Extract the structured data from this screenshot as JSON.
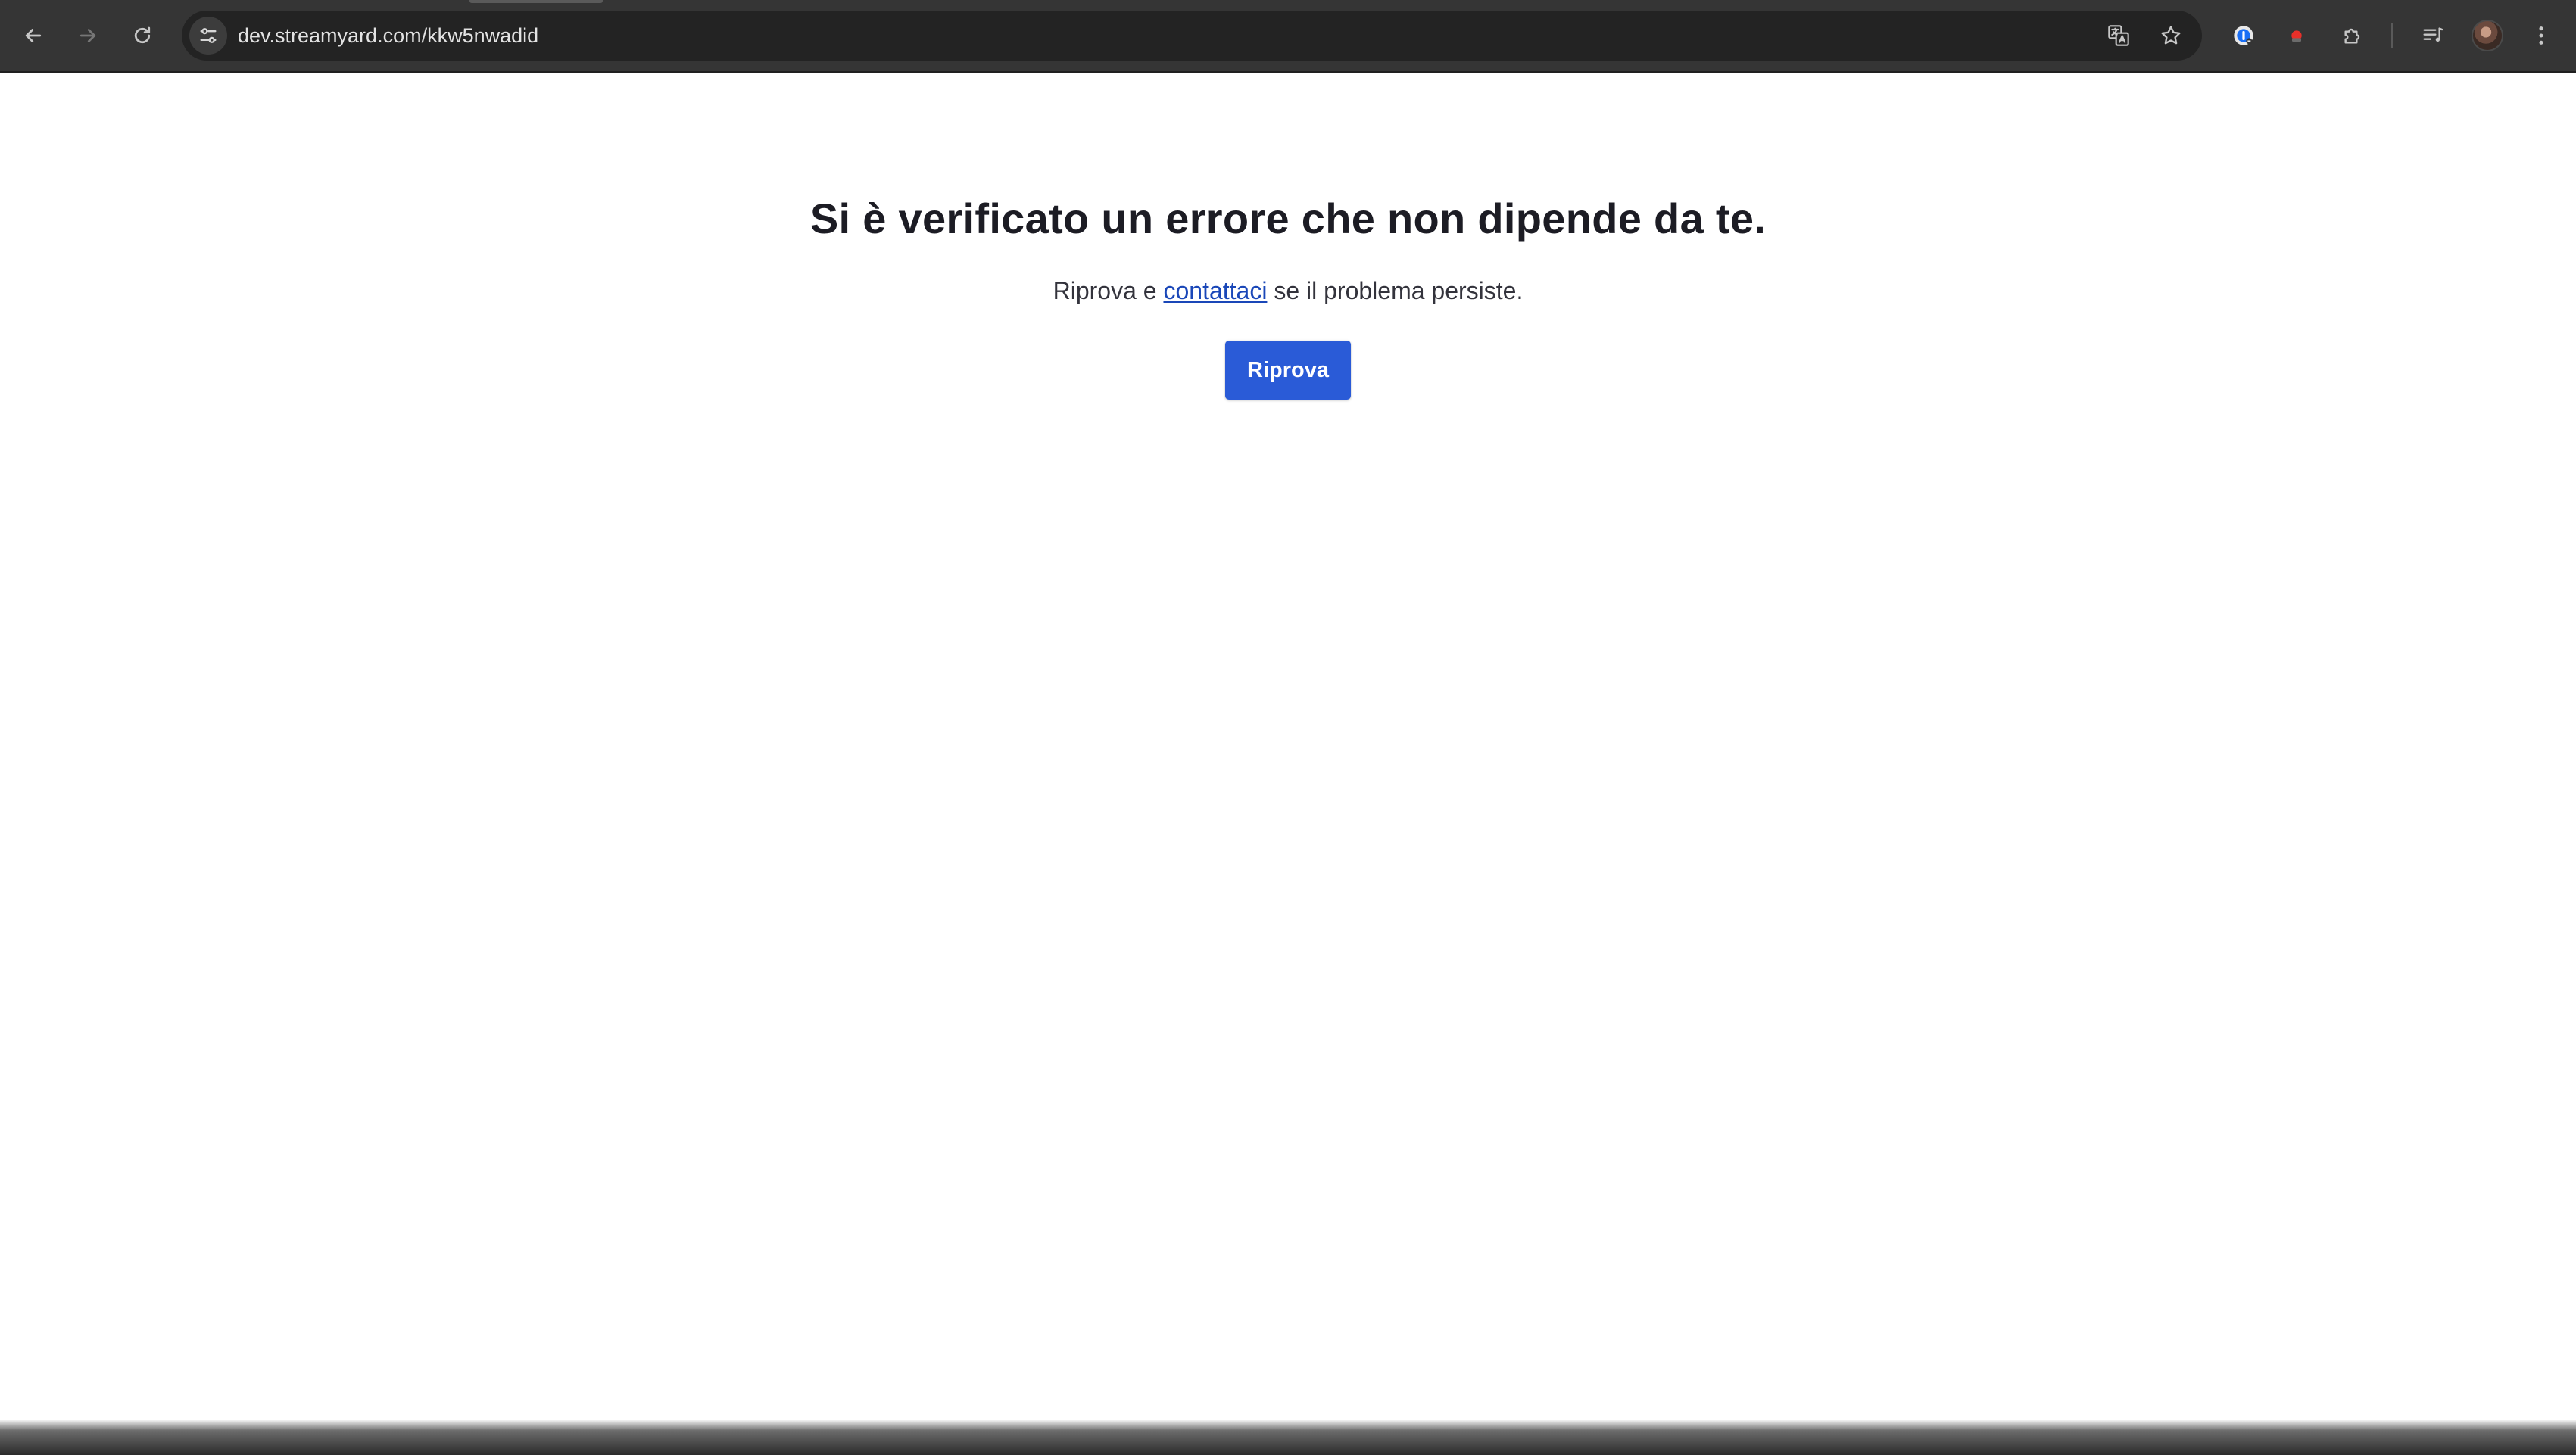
{
  "browser": {
    "url": "dev.streamyard.com/kkw5nwadid",
    "icons": {
      "back": "arrow-left-icon",
      "forward": "arrow-right-icon",
      "reload": "reload-icon",
      "site_info": "tune-icon",
      "translate": "translate-icon",
      "bookmark": "star-icon",
      "extension_1": "password-manager-icon",
      "extension_2": "record-icon",
      "extensions": "puzzle-icon",
      "media": "media-controls-icon",
      "menu": "kebab-menu-icon"
    },
    "colors": {
      "toolbar": "#353535",
      "omnibox": "#232323"
    }
  },
  "page": {
    "title": "Si è verificato un errore che non dipende da te.",
    "message_before": "Riprova e ",
    "contact_link": "contattaci",
    "message_after": " se il problema persiste.",
    "retry_label": "Riprova",
    "colors": {
      "button": "#2a5bd7",
      "link": "#1a47b8",
      "title": "#1c1c24"
    }
  }
}
